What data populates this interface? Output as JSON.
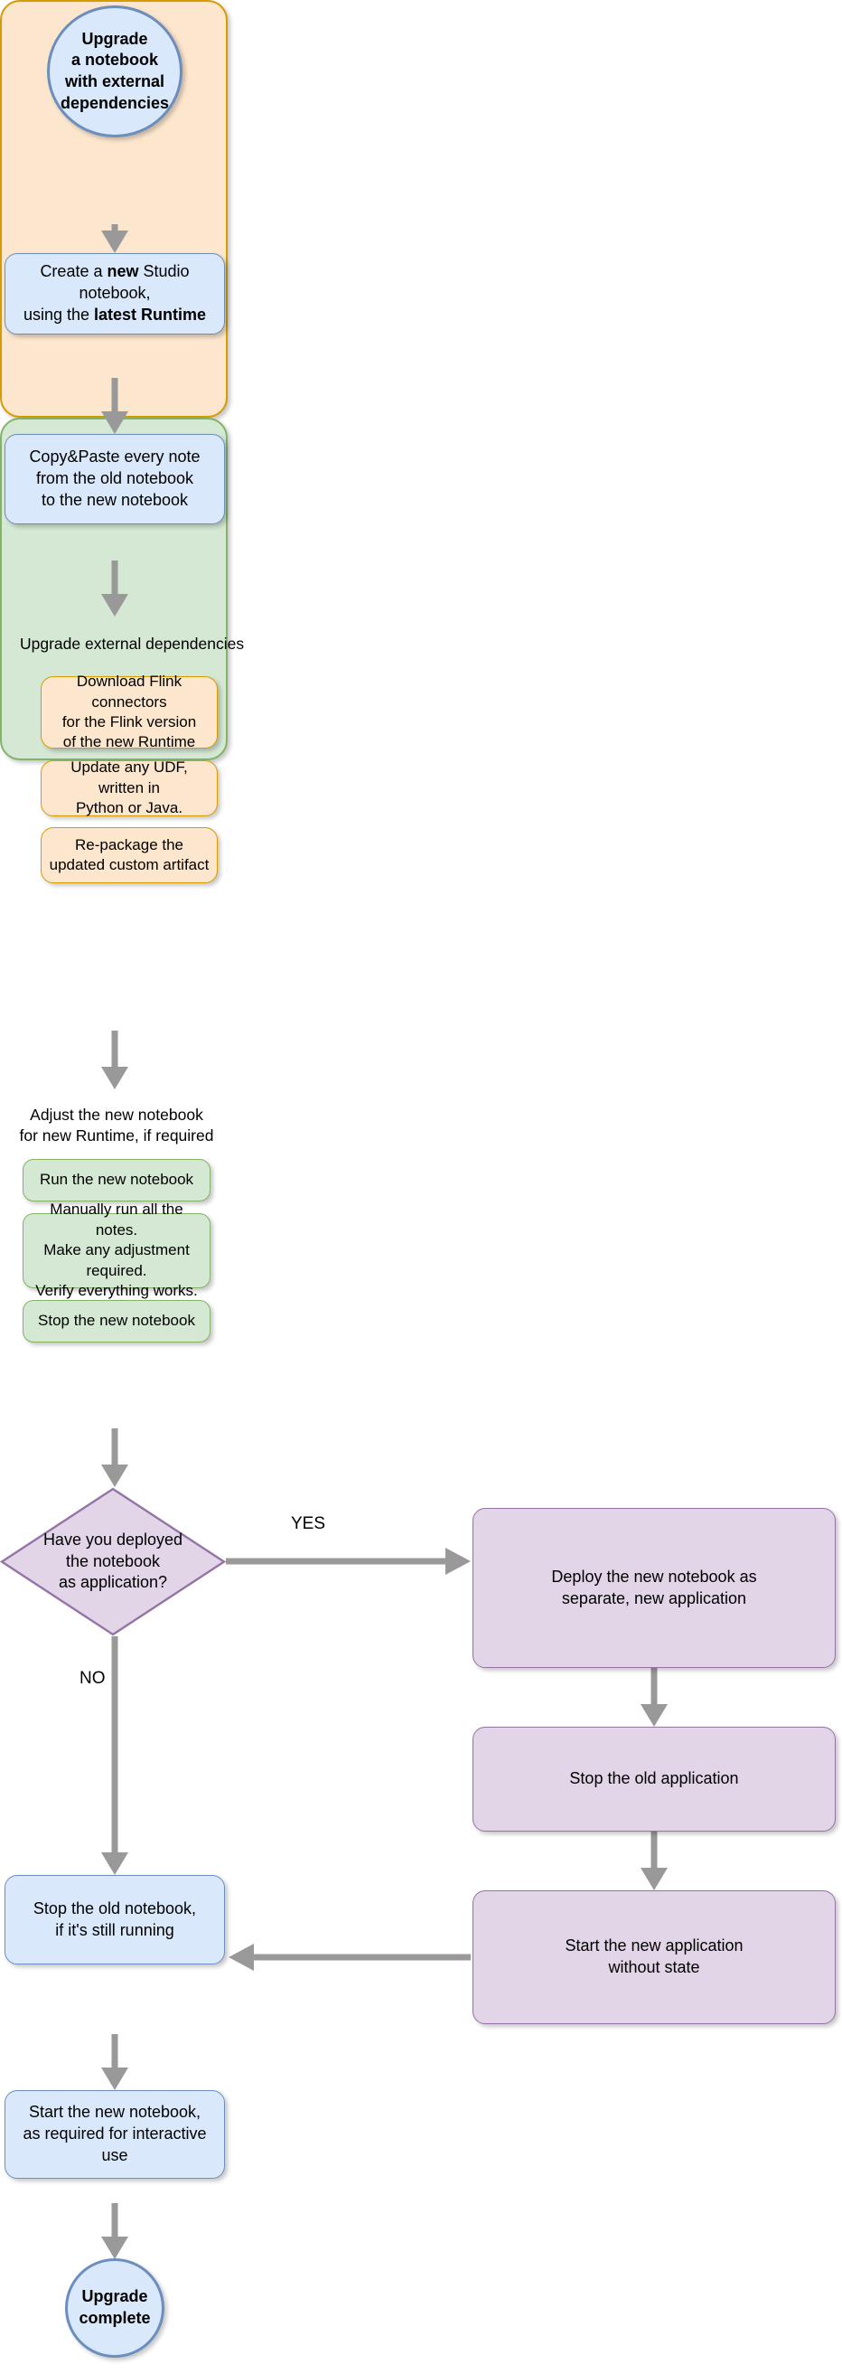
{
  "diagram": {
    "title": "Upgrade a notebook with external dependencies",
    "colors": {
      "blue_fill": "#dae8fc",
      "blue_stroke": "#6c8ebf",
      "orange_fill": "#fce6cd",
      "orange_stroke": "#d79b00",
      "green_fill": "#d5e8d4",
      "green_stroke": "#82b366",
      "purple_fill": "#e1d5e7",
      "purple_stroke": "#9673a6",
      "edge": "#999999",
      "background": "#ffffff"
    }
  },
  "nodes": {
    "start": {
      "lines": [
        "Upgrade",
        "a notebook",
        "with external",
        "dependencies"
      ]
    },
    "create_notebook": {
      "line1_pre": "Create a ",
      "line1_bold": "new",
      "line1_post": " Studio notebook,",
      "line2_pre": "using the ",
      "line2_bold": "latest Runtime"
    },
    "copy_paste": {
      "lines": [
        "Copy&Paste every note",
        "from the old notebook",
        "to the new notebook"
      ]
    },
    "upgrade_deps_group": {
      "title": "Upgrade external dependencies",
      "children": [
        {
          "lines": [
            "Download Flink connectors",
            "for the Flink version",
            "of the new Runtime"
          ]
        },
        {
          "lines": [
            "Update any UDF, written in",
            "Python or Java."
          ]
        },
        {
          "lines": [
            "Re-package the",
            "updated custom artifact"
          ]
        }
      ]
    },
    "adjust_group": {
      "title_lines": [
        "Adjust the new notebook",
        "for new Runtime, if required"
      ],
      "children": [
        {
          "lines": [
            "Run the new notebook"
          ]
        },
        {
          "lines": [
            "Manually run all the notes.",
            "Make any adjustment required.",
            "Verify everything works."
          ]
        },
        {
          "lines": [
            "Stop the new notebook"
          ]
        }
      ]
    },
    "decision": {
      "lines": [
        "Have you deployed",
        "the notebook",
        "as application?"
      ]
    },
    "deploy_new_app": {
      "lines": [
        "Deploy the new notebook as",
        "separate, new application"
      ]
    },
    "stop_old_app": {
      "lines": [
        "Stop the old application"
      ]
    },
    "start_new_app": {
      "lines": [
        "Start the new application",
        "without state"
      ]
    },
    "stop_old_notebook": {
      "lines": [
        "Stop the old notebook,",
        "if it's still running"
      ]
    },
    "start_new_notebook": {
      "lines": [
        "Start the new notebook,",
        "as required for interactive use"
      ]
    },
    "end": {
      "lines": [
        "Upgrade",
        "complete"
      ]
    }
  },
  "edge_labels": {
    "yes": "YES",
    "no": "NO"
  }
}
